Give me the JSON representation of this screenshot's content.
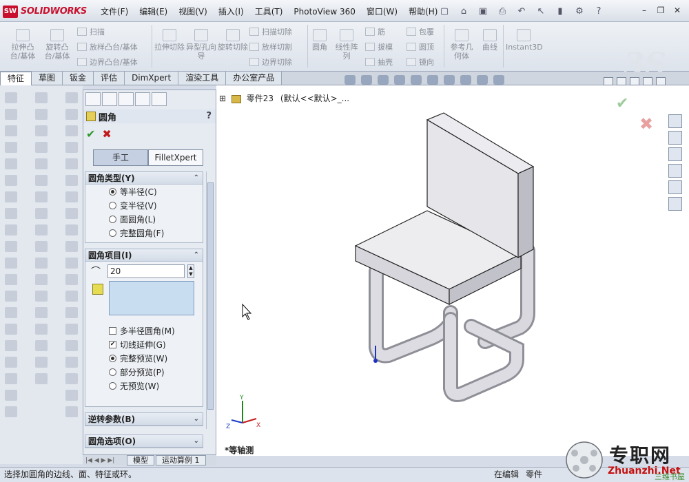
{
  "app": {
    "logo_badge": "SW",
    "logo_text": "SOLIDWORKS"
  },
  "menu": [
    "文件(F)",
    "编辑(E)",
    "视图(V)",
    "插入(I)",
    "工具(T)",
    "PhotoView 360",
    "窗口(W)",
    "帮助(H)"
  ],
  "command_manager": {
    "extrude_boss": "拉伸凸台/基体",
    "revolve_boss": "旋转凸台/基体",
    "sweep": "扫描",
    "loft": "放样凸台/基体",
    "boundary": "边界凸台/基体",
    "extrude_cut": "拉伸切除",
    "hole_wizard": "异型孔向导",
    "revolve_cut": "旋转切除",
    "sweep_cut": "扫描切除",
    "loft_cut": "放样切割",
    "boundary_cut": "边界切除",
    "fillet": "圆角",
    "linear_pattern": "线性阵列",
    "rib": "筋",
    "draft": "拔模",
    "shell": "抽壳",
    "wrap": "包覆",
    "dome": "圆顶",
    "mirror": "镜向",
    "ref_geometry": "参考几何体",
    "curves": "曲线",
    "instant3d": "Instant3D"
  },
  "tabs": [
    "特征",
    "草图",
    "钣金",
    "评估",
    "DimXpert",
    "渲染工具",
    "办公室产品"
  ],
  "property_manager": {
    "title": "圆角",
    "help": "?",
    "modes": [
      "手工",
      "FilletXpert"
    ],
    "fillet_type": {
      "header": "圆角类型(Y)",
      "options": [
        "等半径(C)",
        "变半径(V)",
        "面圆角(L)",
        "完整圆角(F)"
      ],
      "selected": 0
    },
    "fillet_items": {
      "header": "圆角项目(I)",
      "radius": "20",
      "multi_radius": "多半径圆角(M)",
      "tangent": "切线延伸(G)",
      "preview_options": [
        "完整预览(W)",
        "部分预览(P)",
        "无预览(W)"
      ],
      "preview_selected": 0
    },
    "setback": "逆转参数(B)",
    "options": "圆角选项(O)"
  },
  "tree": {
    "part_name": "零件23",
    "config": "(默认<<默认>_..."
  },
  "view": {
    "name": "*等轴测",
    "triad": {
      "x": "X",
      "y": "Y",
      "z": "Z"
    }
  },
  "bottom_tabs": [
    "模型",
    "运动算例 1"
  ],
  "status": {
    "message": "选择加圆角的边线、面、特征或环。",
    "editing": "在编辑",
    "doc_type": "零件"
  },
  "watermark": {
    "cn": "专职网",
    "site": "Zhuanzhi.Net",
    "sub": "三维书屋"
  }
}
